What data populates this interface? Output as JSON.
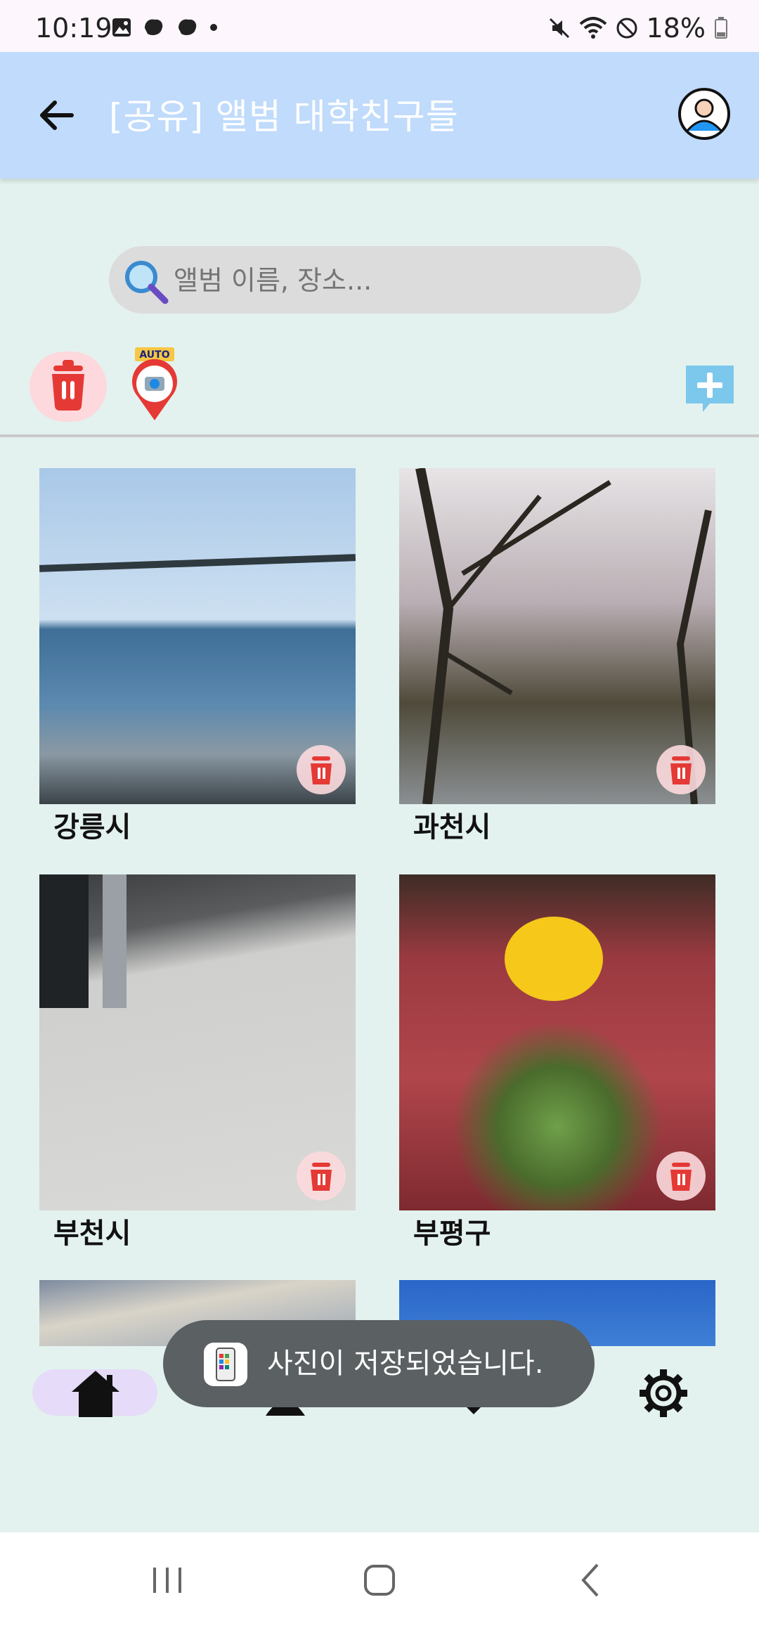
{
  "status_bar": {
    "time": "10:19",
    "battery": "18%"
  },
  "header": {
    "title": "[공유] 앨범 대학친구들"
  },
  "search": {
    "placeholder": "앨범 이름, 장소..."
  },
  "toolbar": {
    "auto_badge": "AUTO"
  },
  "albums": [
    {
      "name": "강릉시"
    },
    {
      "name": "과천시"
    },
    {
      "name": "부천시"
    },
    {
      "name": "부평구"
    },
    {
      "name": ""
    },
    {
      "name": ""
    }
  ],
  "toast": {
    "message": "사진이 저장되었습니다."
  },
  "colors": {
    "appbar": "#c0dbfb",
    "background": "#e3f2ef",
    "accent_red": "#e53935",
    "nav_selected": "#e6dbf8"
  },
  "icons": [
    "back-arrow-icon",
    "avatar-icon",
    "search-icon",
    "trash-icon",
    "auto-map-pin-icon",
    "add-icon",
    "home-icon",
    "people-icon",
    "heart-icon",
    "gear-icon"
  ]
}
